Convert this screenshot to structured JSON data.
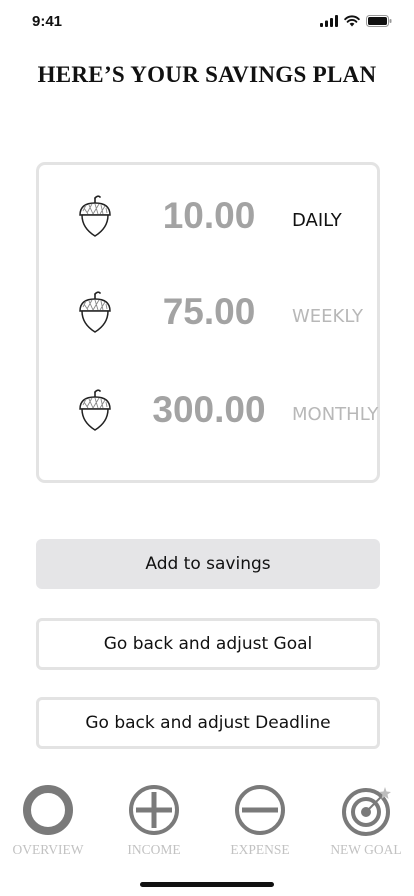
{
  "status_bar": {
    "time": "9:41",
    "icons": [
      "signal-icon",
      "wifi-icon",
      "battery-icon"
    ]
  },
  "page": {
    "title": "HERE’S YOUR SAVINGS PLAN"
  },
  "plan": {
    "rows": [
      {
        "icon": "acorn-icon",
        "amount": "10.00",
        "period": "DAILY",
        "selected": true
      },
      {
        "icon": "acorn-icon",
        "amount": "75.00",
        "period": "WEEKLY",
        "selected": false
      },
      {
        "icon": "acorn-icon",
        "amount": "300.00",
        "period": "MONTHLY",
        "selected": false
      }
    ]
  },
  "actions": {
    "add_to_savings": "Add to savings",
    "adjust_goal": "Go back and adjust Goal",
    "adjust_deadline": "Go back and adjust Deadline"
  },
  "tab_bar": {
    "tabs": [
      {
        "label": "OVERVIEW",
        "icon": "overview-icon"
      },
      {
        "label": "INCOME",
        "icon": "plus-circle-icon"
      },
      {
        "label": "EXPENSE",
        "icon": "minus-circle-icon"
      },
      {
        "label": "NEW GOAL",
        "icon": "target-icon"
      }
    ]
  },
  "colors": {
    "amount_text": "#a3a3a3",
    "card_border": "#e3e3e3",
    "primary_button_bg": "#e5e5e7",
    "tab_icon": "#7a7a7a",
    "tab_label": "#c2c2c2"
  }
}
